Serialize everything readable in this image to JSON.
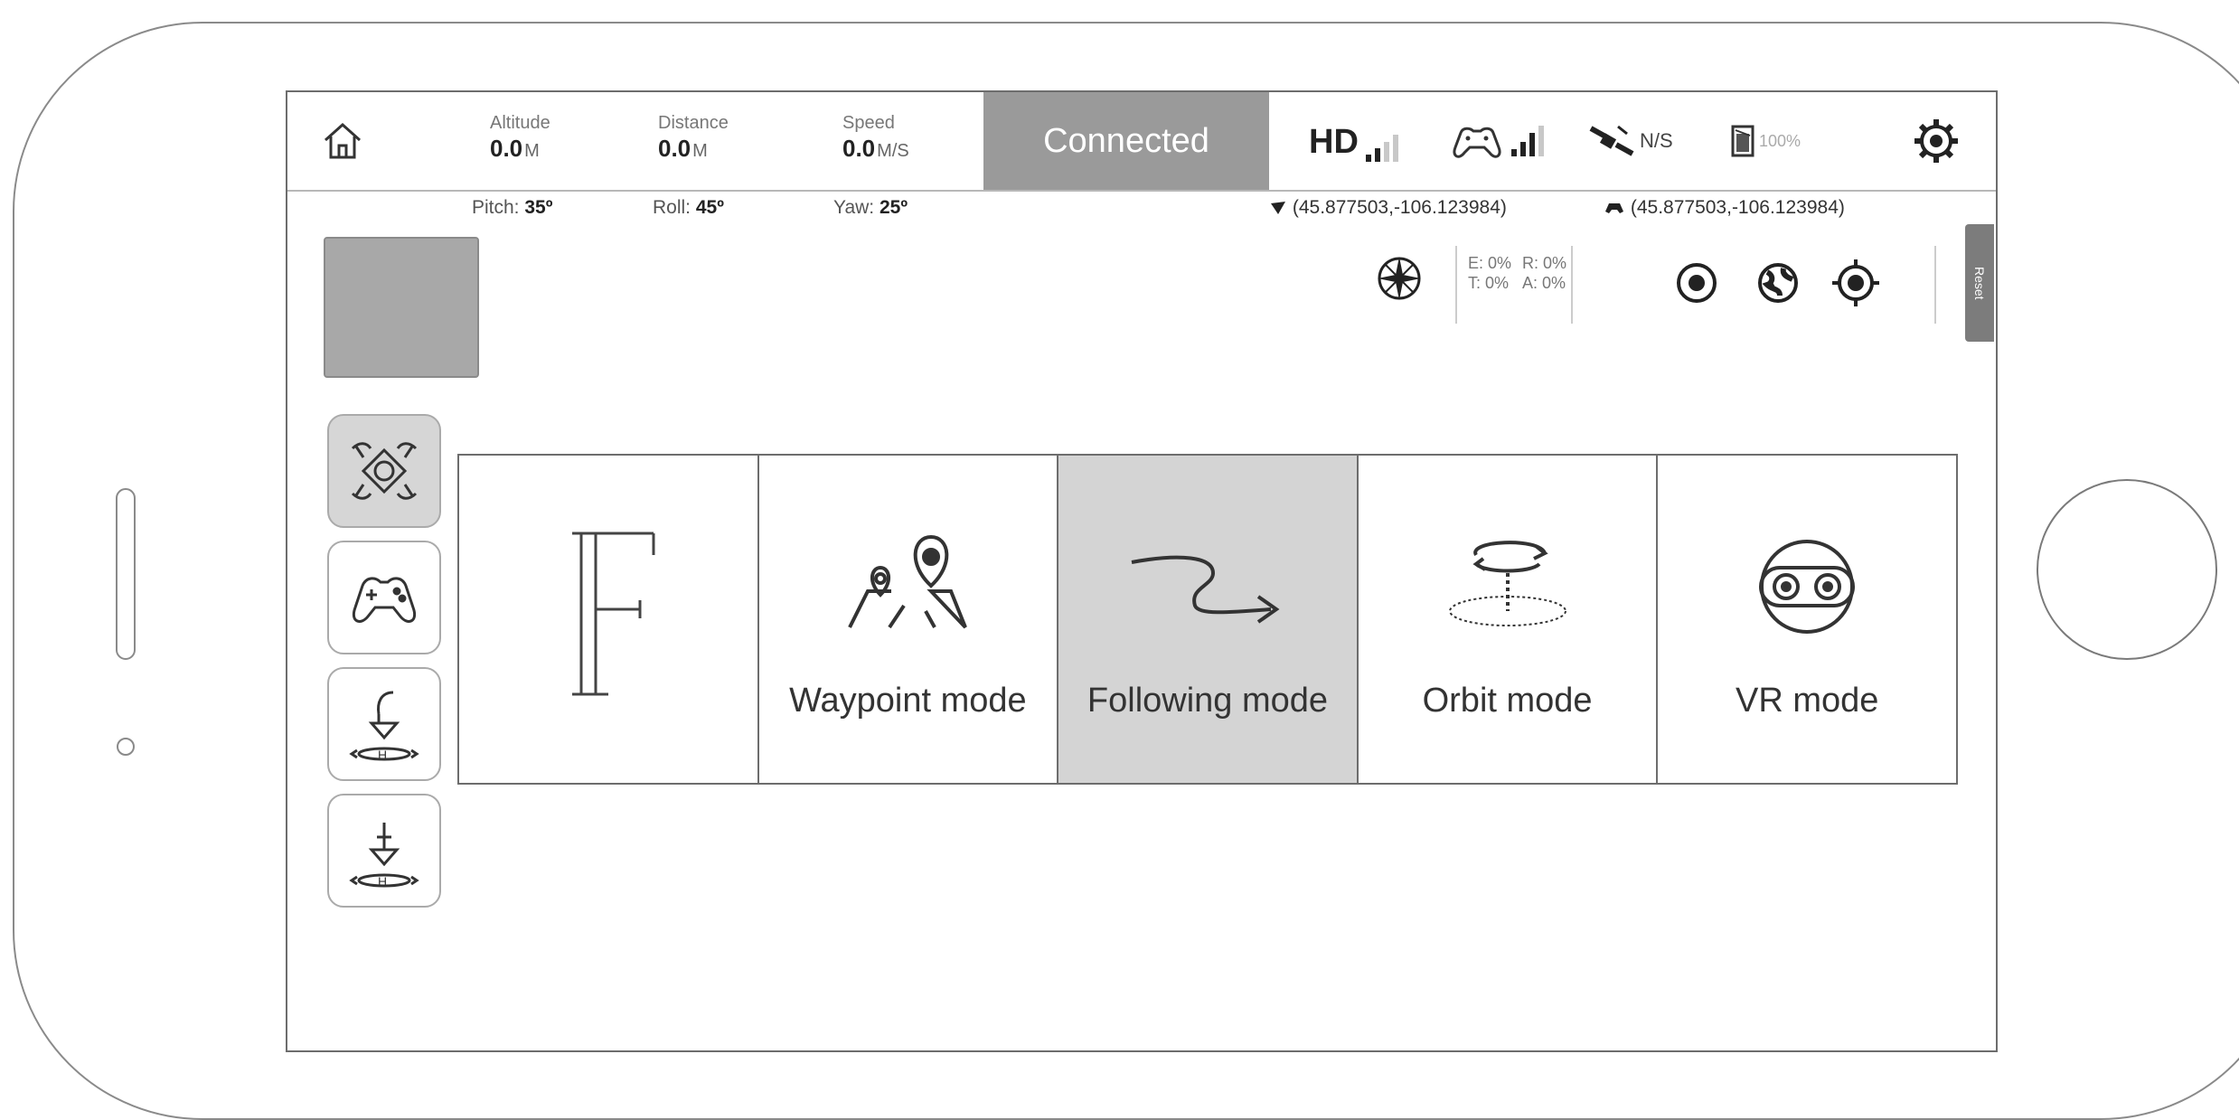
{
  "topbar": {
    "altitude": {
      "label": "Altitude",
      "value": "0.0",
      "unit": "M"
    },
    "distance": {
      "label": "Distance",
      "value": "0.0",
      "unit": "M"
    },
    "speed": {
      "label": "Speed",
      "value": "0.0",
      "unit": "M/S"
    },
    "status": "Connected",
    "hd_label": "HD",
    "gps_label": "N/S",
    "battery_label": "100%",
    "icons": [
      "home-icon",
      "hd-signal-icon",
      "controller-signal-icon",
      "satellite-icon",
      "battery-icon",
      "settings-icon"
    ]
  },
  "attitude": {
    "pitch_label": "Pitch:",
    "pitch_value": "35º",
    "roll_label": "Roll:",
    "roll_value": "45º",
    "yaw_label": "Yaw:",
    "yaw_value": "25º"
  },
  "coordinates": {
    "drone": "(45.877503,-106.123984)",
    "controller": "(45.877503,-106.123984)"
  },
  "sensors": {
    "e": "E: 0%",
    "r": "R: 0%",
    "t": "T: 0%",
    "a": "A: 0%"
  },
  "side_tab": "Reset",
  "left_tools": [
    "drone-icon",
    "gamepad-icon",
    "takeoff-icon",
    "landing-icon"
  ],
  "modes": [
    {
      "label": "",
      "icon": "f-logo-icon",
      "selected": false
    },
    {
      "label": "Waypoint mode",
      "icon": "map-pin-icon",
      "selected": false
    },
    {
      "label": "Following mode",
      "icon": "follow-arrow-icon",
      "selected": true
    },
    {
      "label": "Orbit mode",
      "icon": "orbit-icon",
      "selected": false
    },
    {
      "label": "VR mode",
      "icon": "vr-headset-icon",
      "selected": false
    }
  ]
}
